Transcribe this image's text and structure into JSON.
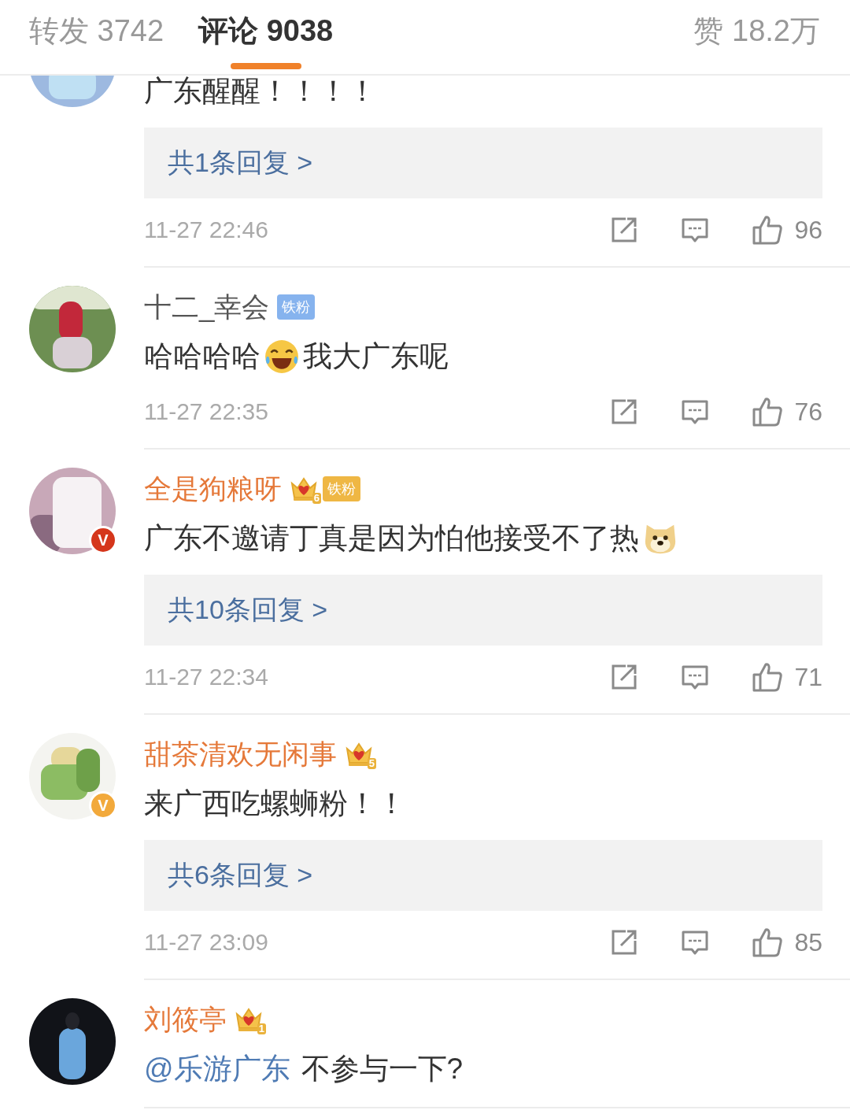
{
  "tabs": [
    {
      "label": "转发 3742",
      "selected": false
    },
    {
      "label": "评论 9038",
      "selected": true
    }
  ],
  "likes_tab": {
    "label": "赞 18.2万"
  },
  "comments": [
    {
      "avatar": {
        "kind": "picture"
      },
      "segments": [
        {
          "kind": "text",
          "text": "广东醒醒！！！！"
        }
      ],
      "replies": "共1条回复 >",
      "time": "11-27 22:46",
      "likes": "96"
    },
    {
      "avatar": {
        "kind": "picture"
      },
      "name": "十二_幸会",
      "vip": false,
      "fan_badge": "铁粉",
      "segments": [
        {
          "kind": "text",
          "text": "哈哈哈哈"
        },
        {
          "kind": "laugh"
        },
        {
          "kind": "text",
          "text": "我大广东呢"
        }
      ],
      "time": "11-27 22:35",
      "likes": "76"
    },
    {
      "avatar": {
        "kind": "picture"
      },
      "verified": {
        "mark": "V",
        "color": "#d5361b"
      },
      "name": "全是狗粮呀",
      "vip": true,
      "crown_level": "6",
      "fan_badge": "铁粉",
      "segments": [
        {
          "kind": "text",
          "text": "广东不邀请丁真是因为怕他接受不了热"
        },
        {
          "kind": "doge"
        }
      ],
      "replies": "共10条回复 >",
      "time": "11-27 22:34",
      "likes": "71"
    },
    {
      "avatar": {
        "kind": "picture"
      },
      "verified": {
        "mark": "V",
        "color": "#f2a93b"
      },
      "name": "甜茶清欢无闲事",
      "vip": true,
      "crown_level": "5",
      "segments": [
        {
          "kind": "text",
          "text": "来广西吃螺蛳粉！！"
        }
      ],
      "replies": "共6条回复 >",
      "time": "11-27 23:09",
      "likes": "85"
    },
    {
      "avatar": {
        "kind": "picture"
      },
      "name": "刘筱亭",
      "vip": true,
      "crown_level": "1",
      "segments": [
        {
          "kind": "mention",
          "text": "@乐游广东"
        },
        {
          "kind": "text",
          "text": "不参与一下?"
        }
      ]
    }
  ]
}
